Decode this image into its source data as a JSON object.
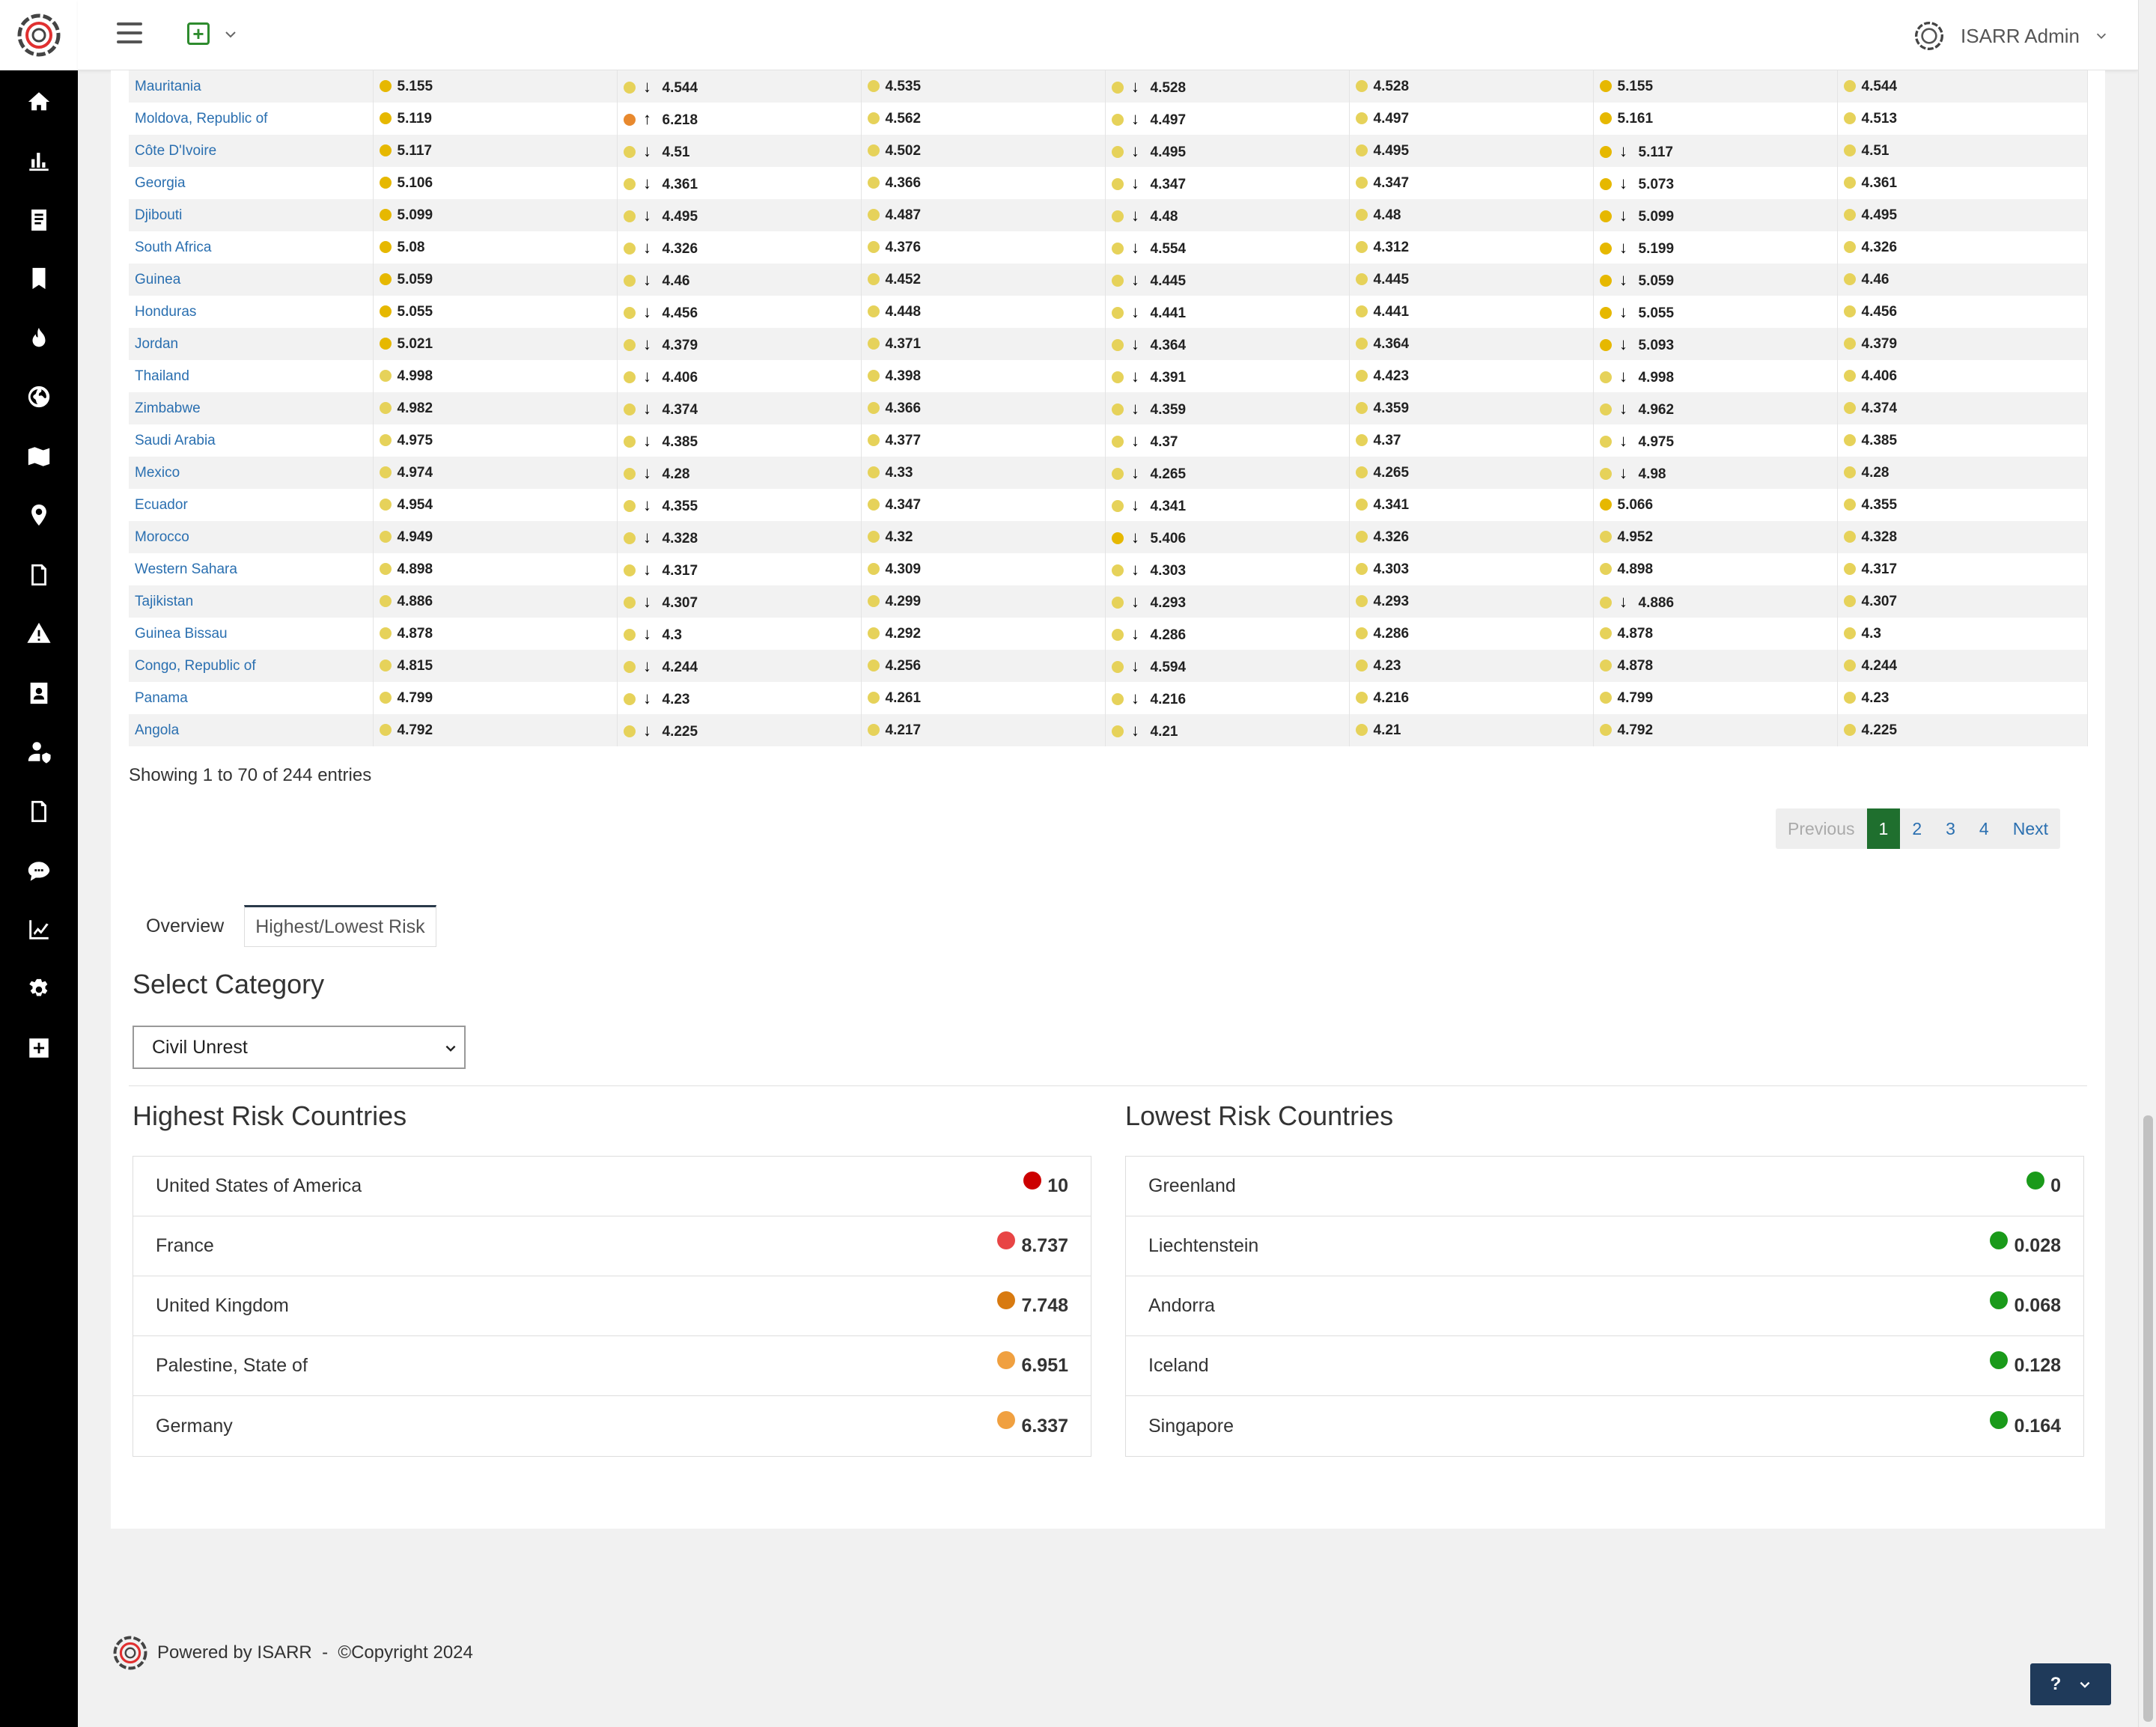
{
  "header": {
    "user_name": "ISARR Admin"
  },
  "table": {
    "rows": [
      {
        "country": "Mauritania",
        "c1": {
          "dot": "#e6b800",
          "arrow": "",
          "value": "5.155"
        },
        "c2": {
          "dot": "#e6d25a",
          "arrow": "down",
          "value": "4.544"
        },
        "c3": {
          "dot": "#e6d25a",
          "arrow": "",
          "value": "4.535"
        },
        "c4": {
          "dot": "#e6d25a",
          "arrow": "down",
          "value": "4.528"
        },
        "c5": {
          "dot": "#e6d25a",
          "arrow": "",
          "value": "4.528"
        },
        "c6": {
          "dot": "#e6b800",
          "arrow": "",
          "value": "5.155"
        },
        "c7": {
          "dot": "#e6d25a",
          "arrow": "",
          "value": "4.544"
        }
      },
      {
        "country": "Moldova, Republic of",
        "c1": {
          "dot": "#e6b800",
          "arrow": "",
          "value": "5.119"
        },
        "c2": {
          "dot": "#e8892e",
          "arrow": "up",
          "value": "6.218"
        },
        "c3": {
          "dot": "#e6d25a",
          "arrow": "",
          "value": "4.562"
        },
        "c4": {
          "dot": "#e6d25a",
          "arrow": "down",
          "value": "4.497"
        },
        "c5": {
          "dot": "#e6d25a",
          "arrow": "",
          "value": "4.497"
        },
        "c6": {
          "dot": "#e6b800",
          "arrow": "",
          "value": "5.161"
        },
        "c7": {
          "dot": "#e6d25a",
          "arrow": "",
          "value": "4.513"
        }
      },
      {
        "country": "Côte D'Ivoire",
        "c1": {
          "dot": "#e6b800",
          "arrow": "",
          "value": "5.117"
        },
        "c2": {
          "dot": "#e6d25a",
          "arrow": "down",
          "value": "4.51"
        },
        "c3": {
          "dot": "#e6d25a",
          "arrow": "",
          "value": "4.502"
        },
        "c4": {
          "dot": "#e6d25a",
          "arrow": "down",
          "value": "4.495"
        },
        "c5": {
          "dot": "#e6d25a",
          "arrow": "",
          "value": "4.495"
        },
        "c6": {
          "dot": "#e6b800",
          "arrow": "down",
          "value": "5.117"
        },
        "c7": {
          "dot": "#e6d25a",
          "arrow": "",
          "value": "4.51"
        }
      },
      {
        "country": "Georgia",
        "c1": {
          "dot": "#e6b800",
          "arrow": "",
          "value": "5.106"
        },
        "c2": {
          "dot": "#e6d25a",
          "arrow": "down",
          "value": "4.361"
        },
        "c3": {
          "dot": "#e6d25a",
          "arrow": "",
          "value": "4.366"
        },
        "c4": {
          "dot": "#e6d25a",
          "arrow": "down",
          "value": "4.347"
        },
        "c5": {
          "dot": "#e6d25a",
          "arrow": "",
          "value": "4.347"
        },
        "c6": {
          "dot": "#e6b800",
          "arrow": "down",
          "value": "5.073"
        },
        "c7": {
          "dot": "#e6d25a",
          "arrow": "",
          "value": "4.361"
        }
      },
      {
        "country": "Djibouti",
        "c1": {
          "dot": "#e6b800",
          "arrow": "",
          "value": "5.099"
        },
        "c2": {
          "dot": "#e6d25a",
          "arrow": "down",
          "value": "4.495"
        },
        "c3": {
          "dot": "#e6d25a",
          "arrow": "",
          "value": "4.487"
        },
        "c4": {
          "dot": "#e6d25a",
          "arrow": "down",
          "value": "4.48"
        },
        "c5": {
          "dot": "#e6d25a",
          "arrow": "",
          "value": "4.48"
        },
        "c6": {
          "dot": "#e6b800",
          "arrow": "down",
          "value": "5.099"
        },
        "c7": {
          "dot": "#e6d25a",
          "arrow": "",
          "value": "4.495"
        }
      },
      {
        "country": "South Africa",
        "c1": {
          "dot": "#e6b800",
          "arrow": "",
          "value": "5.08"
        },
        "c2": {
          "dot": "#e6d25a",
          "arrow": "down",
          "value": "4.326"
        },
        "c3": {
          "dot": "#e6d25a",
          "arrow": "",
          "value": "4.376"
        },
        "c4": {
          "dot": "#e6d25a",
          "arrow": "down",
          "value": "4.554"
        },
        "c5": {
          "dot": "#e6d25a",
          "arrow": "",
          "value": "4.312"
        },
        "c6": {
          "dot": "#e6b800",
          "arrow": "down",
          "value": "5.199"
        },
        "c7": {
          "dot": "#e6d25a",
          "arrow": "",
          "value": "4.326"
        }
      },
      {
        "country": "Guinea",
        "c1": {
          "dot": "#e6b800",
          "arrow": "",
          "value": "5.059"
        },
        "c2": {
          "dot": "#e6d25a",
          "arrow": "down",
          "value": "4.46"
        },
        "c3": {
          "dot": "#e6d25a",
          "arrow": "",
          "value": "4.452"
        },
        "c4": {
          "dot": "#e6d25a",
          "arrow": "down",
          "value": "4.445"
        },
        "c5": {
          "dot": "#e6d25a",
          "arrow": "",
          "value": "4.445"
        },
        "c6": {
          "dot": "#e6b800",
          "arrow": "down",
          "value": "5.059"
        },
        "c7": {
          "dot": "#e6d25a",
          "arrow": "",
          "value": "4.46"
        }
      },
      {
        "country": "Honduras",
        "c1": {
          "dot": "#e6b800",
          "arrow": "",
          "value": "5.055"
        },
        "c2": {
          "dot": "#e6d25a",
          "arrow": "down",
          "value": "4.456"
        },
        "c3": {
          "dot": "#e6d25a",
          "arrow": "",
          "value": "4.448"
        },
        "c4": {
          "dot": "#e6d25a",
          "arrow": "down",
          "value": "4.441"
        },
        "c5": {
          "dot": "#e6d25a",
          "arrow": "",
          "value": "4.441"
        },
        "c6": {
          "dot": "#e6b800",
          "arrow": "down",
          "value": "5.055"
        },
        "c7": {
          "dot": "#e6d25a",
          "arrow": "",
          "value": "4.456"
        }
      },
      {
        "country": "Jordan",
        "c1": {
          "dot": "#e6b800",
          "arrow": "",
          "value": "5.021"
        },
        "c2": {
          "dot": "#e6d25a",
          "arrow": "down",
          "value": "4.379"
        },
        "c3": {
          "dot": "#e6d25a",
          "arrow": "",
          "value": "4.371"
        },
        "c4": {
          "dot": "#e6d25a",
          "arrow": "down",
          "value": "4.364"
        },
        "c5": {
          "dot": "#e6d25a",
          "arrow": "",
          "value": "4.364"
        },
        "c6": {
          "dot": "#e6b800",
          "arrow": "down",
          "value": "5.093"
        },
        "c7": {
          "dot": "#e6d25a",
          "arrow": "",
          "value": "4.379"
        }
      },
      {
        "country": "Thailand",
        "c1": {
          "dot": "#e6d25a",
          "arrow": "",
          "value": "4.998"
        },
        "c2": {
          "dot": "#e6d25a",
          "arrow": "down",
          "value": "4.406"
        },
        "c3": {
          "dot": "#e6d25a",
          "arrow": "",
          "value": "4.398"
        },
        "c4": {
          "dot": "#e6d25a",
          "arrow": "down",
          "value": "4.391"
        },
        "c5": {
          "dot": "#e6d25a",
          "arrow": "",
          "value": "4.423"
        },
        "c6": {
          "dot": "#e6d25a",
          "arrow": "down",
          "value": "4.998"
        },
        "c7": {
          "dot": "#e6d25a",
          "arrow": "",
          "value": "4.406"
        }
      },
      {
        "country": "Zimbabwe",
        "c1": {
          "dot": "#e6d25a",
          "arrow": "",
          "value": "4.982"
        },
        "c2": {
          "dot": "#e6d25a",
          "arrow": "down",
          "value": "4.374"
        },
        "c3": {
          "dot": "#e6d25a",
          "arrow": "",
          "value": "4.366"
        },
        "c4": {
          "dot": "#e6d25a",
          "arrow": "down",
          "value": "4.359"
        },
        "c5": {
          "dot": "#e6d25a",
          "arrow": "",
          "value": "4.359"
        },
        "c6": {
          "dot": "#e6d25a",
          "arrow": "down",
          "value": "4.962"
        },
        "c7": {
          "dot": "#e6d25a",
          "arrow": "",
          "value": "4.374"
        }
      },
      {
        "country": "Saudi Arabia",
        "c1": {
          "dot": "#e6d25a",
          "arrow": "",
          "value": "4.975"
        },
        "c2": {
          "dot": "#e6d25a",
          "arrow": "down",
          "value": "4.385"
        },
        "c3": {
          "dot": "#e6d25a",
          "arrow": "",
          "value": "4.377"
        },
        "c4": {
          "dot": "#e6d25a",
          "arrow": "down",
          "value": "4.37"
        },
        "c5": {
          "dot": "#e6d25a",
          "arrow": "",
          "value": "4.37"
        },
        "c6": {
          "dot": "#e6d25a",
          "arrow": "down",
          "value": "4.975"
        },
        "c7": {
          "dot": "#e6d25a",
          "arrow": "",
          "value": "4.385"
        }
      },
      {
        "country": "Mexico",
        "c1": {
          "dot": "#e6d25a",
          "arrow": "",
          "value": "4.974"
        },
        "c2": {
          "dot": "#e6d25a",
          "arrow": "down",
          "value": "4.28"
        },
        "c3": {
          "dot": "#e6d25a",
          "arrow": "",
          "value": "4.33"
        },
        "c4": {
          "dot": "#e6d25a",
          "arrow": "down",
          "value": "4.265"
        },
        "c5": {
          "dot": "#e6d25a",
          "arrow": "",
          "value": "4.265"
        },
        "c6": {
          "dot": "#e6d25a",
          "arrow": "down",
          "value": "4.98"
        },
        "c7": {
          "dot": "#e6d25a",
          "arrow": "",
          "value": "4.28"
        }
      },
      {
        "country": "Ecuador",
        "c1": {
          "dot": "#e6d25a",
          "arrow": "",
          "value": "4.954"
        },
        "c2": {
          "dot": "#e6d25a",
          "arrow": "down",
          "value": "4.355"
        },
        "c3": {
          "dot": "#e6d25a",
          "arrow": "",
          "value": "4.347"
        },
        "c4": {
          "dot": "#e6d25a",
          "arrow": "down",
          "value": "4.341"
        },
        "c5": {
          "dot": "#e6d25a",
          "arrow": "",
          "value": "4.341"
        },
        "c6": {
          "dot": "#e6b800",
          "arrow": "",
          "value": "5.066"
        },
        "c7": {
          "dot": "#e6d25a",
          "arrow": "",
          "value": "4.355"
        }
      },
      {
        "country": "Morocco",
        "c1": {
          "dot": "#e6d25a",
          "arrow": "",
          "value": "4.949"
        },
        "c2": {
          "dot": "#e6d25a",
          "arrow": "down",
          "value": "4.328"
        },
        "c3": {
          "dot": "#e6d25a",
          "arrow": "",
          "value": "4.32"
        },
        "c4": {
          "dot": "#e6b800",
          "arrow": "down",
          "value": "5.406"
        },
        "c5": {
          "dot": "#e6d25a",
          "arrow": "",
          "value": "4.326"
        },
        "c6": {
          "dot": "#e6d25a",
          "arrow": "",
          "value": "4.952"
        },
        "c7": {
          "dot": "#e6d25a",
          "arrow": "",
          "value": "4.328"
        }
      },
      {
        "country": "Western Sahara",
        "c1": {
          "dot": "#e6d25a",
          "arrow": "",
          "value": "4.898"
        },
        "c2": {
          "dot": "#e6d25a",
          "arrow": "down",
          "value": "4.317"
        },
        "c3": {
          "dot": "#e6d25a",
          "arrow": "",
          "value": "4.309"
        },
        "c4": {
          "dot": "#e6d25a",
          "arrow": "down",
          "value": "4.303"
        },
        "c5": {
          "dot": "#e6d25a",
          "arrow": "",
          "value": "4.303"
        },
        "c6": {
          "dot": "#e6d25a",
          "arrow": "",
          "value": "4.898"
        },
        "c7": {
          "dot": "#e6d25a",
          "arrow": "",
          "value": "4.317"
        }
      },
      {
        "country": "Tajikistan",
        "c1": {
          "dot": "#e6d25a",
          "arrow": "",
          "value": "4.886"
        },
        "c2": {
          "dot": "#e6d25a",
          "arrow": "down",
          "value": "4.307"
        },
        "c3": {
          "dot": "#e6d25a",
          "arrow": "",
          "value": "4.299"
        },
        "c4": {
          "dot": "#e6d25a",
          "arrow": "down",
          "value": "4.293"
        },
        "c5": {
          "dot": "#e6d25a",
          "arrow": "",
          "value": "4.293"
        },
        "c6": {
          "dot": "#e6d25a",
          "arrow": "down",
          "value": "4.886"
        },
        "c7": {
          "dot": "#e6d25a",
          "arrow": "",
          "value": "4.307"
        }
      },
      {
        "country": "Guinea Bissau",
        "c1": {
          "dot": "#e6d25a",
          "arrow": "",
          "value": "4.878"
        },
        "c2": {
          "dot": "#e6d25a",
          "arrow": "down",
          "value": "4.3"
        },
        "c3": {
          "dot": "#e6d25a",
          "arrow": "",
          "value": "4.292"
        },
        "c4": {
          "dot": "#e6d25a",
          "arrow": "down",
          "value": "4.286"
        },
        "c5": {
          "dot": "#e6d25a",
          "arrow": "",
          "value": "4.286"
        },
        "c6": {
          "dot": "#e6d25a",
          "arrow": "",
          "value": "4.878"
        },
        "c7": {
          "dot": "#e6d25a",
          "arrow": "",
          "value": "4.3"
        }
      },
      {
        "country": "Congo, Republic of",
        "c1": {
          "dot": "#e6d25a",
          "arrow": "",
          "value": "4.815"
        },
        "c2": {
          "dot": "#e6d25a",
          "arrow": "down",
          "value": "4.244"
        },
        "c3": {
          "dot": "#e6d25a",
          "arrow": "",
          "value": "4.256"
        },
        "c4": {
          "dot": "#e6d25a",
          "arrow": "down",
          "value": "4.594"
        },
        "c5": {
          "dot": "#e6d25a",
          "arrow": "",
          "value": "4.23"
        },
        "c6": {
          "dot": "#e6d25a",
          "arrow": "",
          "value": "4.878"
        },
        "c7": {
          "dot": "#e6d25a",
          "arrow": "",
          "value": "4.244"
        }
      },
      {
        "country": "Panama",
        "c1": {
          "dot": "#e6d25a",
          "arrow": "",
          "value": "4.799"
        },
        "c2": {
          "dot": "#e6d25a",
          "arrow": "down",
          "value": "4.23"
        },
        "c3": {
          "dot": "#e6d25a",
          "arrow": "",
          "value": "4.261"
        },
        "c4": {
          "dot": "#e6d25a",
          "arrow": "down",
          "value": "4.216"
        },
        "c5": {
          "dot": "#e6d25a",
          "arrow": "",
          "value": "4.216"
        },
        "c6": {
          "dot": "#e6d25a",
          "arrow": "",
          "value": "4.799"
        },
        "c7": {
          "dot": "#e6d25a",
          "arrow": "",
          "value": "4.23"
        }
      },
      {
        "country": "Angola",
        "c1": {
          "dot": "#e6d25a",
          "arrow": "",
          "value": "4.792"
        },
        "c2": {
          "dot": "#e6d25a",
          "arrow": "down",
          "value": "4.225"
        },
        "c3": {
          "dot": "#e6d25a",
          "arrow": "",
          "value": "4.217"
        },
        "c4": {
          "dot": "#e6d25a",
          "arrow": "down",
          "value": "4.21"
        },
        "c5": {
          "dot": "#e6d25a",
          "arrow": "",
          "value": "4.21"
        },
        "c6": {
          "dot": "#e6d25a",
          "arrow": "",
          "value": "4.792"
        },
        "c7": {
          "dot": "#e6d25a",
          "arrow": "",
          "value": "4.225"
        }
      }
    ],
    "info": "Showing 1 to 70 of 244 entries"
  },
  "pagination": {
    "previous": "Previous",
    "pages": [
      "1",
      "2",
      "3",
      "4"
    ],
    "active": "1",
    "next": "Next"
  },
  "tabs": [
    {
      "label": "Overview",
      "active": false
    },
    {
      "label": "Highest/Lowest Risk",
      "active": true
    }
  ],
  "category": {
    "title": "Select Category",
    "selected": "Civil Unrest"
  },
  "highest": {
    "title": "Highest Risk Countries",
    "items": [
      {
        "country": "United States of America",
        "value": "10",
        "color": "#cc0000"
      },
      {
        "country": "France",
        "value": "8.737",
        "color": "#e84545"
      },
      {
        "country": "United Kingdom",
        "value": "7.748",
        "color": "#d87a10"
      },
      {
        "country": "Palestine, State of",
        "value": "6.951",
        "color": "#f0a040"
      },
      {
        "country": "Germany",
        "value": "6.337",
        "color": "#f0a040"
      }
    ]
  },
  "lowest": {
    "title": "Lowest Risk Countries",
    "items": [
      {
        "country": "Greenland",
        "value": "0",
        "color": "#1a9a1a"
      },
      {
        "country": "Liechtenstein",
        "value": "0.028",
        "color": "#1a9a1a"
      },
      {
        "country": "Andorra",
        "value": "0.068",
        "color": "#1a9a1a"
      },
      {
        "country": "Iceland",
        "value": "0.128",
        "color": "#1a9a1a"
      },
      {
        "country": "Singapore",
        "value": "0.164",
        "color": "#1a9a1a"
      }
    ]
  },
  "footer": {
    "text": "Powered by ISARR  -  ©Copyright 2024"
  },
  "help": {
    "label": "?"
  },
  "sidebar": {
    "icons": [
      "home-icon",
      "bar-chart-icon",
      "document-icon",
      "bookmark-icon",
      "fire-icon",
      "globe-icon",
      "map-icon",
      "location-pin-icon",
      "file-icon",
      "warning-icon",
      "contact-book-icon",
      "user-shield-icon",
      "file-edit-icon",
      "chat-icon",
      "line-chart-icon",
      "gear-icon",
      "plus-square-icon"
    ]
  }
}
